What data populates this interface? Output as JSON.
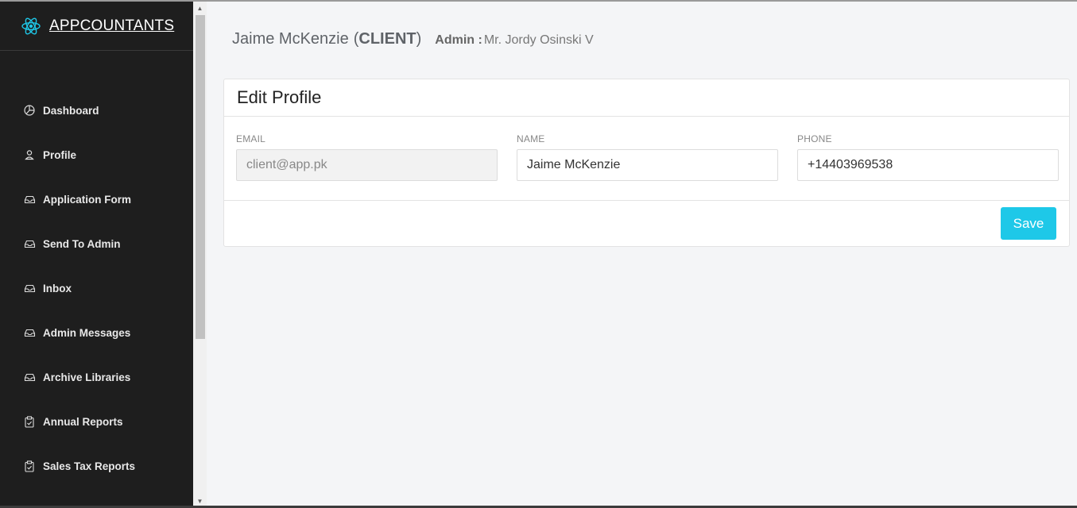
{
  "brand": {
    "title": "APPCOUNTANTS",
    "icon": "react-atom-icon",
    "accent": "#1ec8e8"
  },
  "sidebar": {
    "items": [
      {
        "label": "Dashboard",
        "icon": "pie-chart-icon"
      },
      {
        "label": "Profile",
        "icon": "user-icon"
      },
      {
        "label": "Application Form",
        "icon": "inbox-tray-icon"
      },
      {
        "label": "Send To Admin",
        "icon": "inbox-tray-icon"
      },
      {
        "label": "Inbox",
        "icon": "inbox-tray-icon"
      },
      {
        "label": "Admin Messages",
        "icon": "inbox-tray-icon"
      },
      {
        "label": "Archive Libraries",
        "icon": "inbox-tray-icon"
      },
      {
        "label": "Annual Reports",
        "icon": "clipboard-icon"
      },
      {
        "label": "Sales Tax Reports",
        "icon": "clipboard-icon"
      }
    ]
  },
  "header": {
    "user_name": "Jaime McKenzie",
    "open_paren": "(",
    "role": "CLIENT",
    "close_paren": ")",
    "admin_label": "Admin :",
    "admin_name": "Mr. Jordy Osinski V"
  },
  "profile_form": {
    "title": "Edit Profile",
    "email": {
      "label": "EMAIL",
      "value": "client@app.pk"
    },
    "name": {
      "label": "NAME",
      "value": "Jaime McKenzie"
    },
    "phone": {
      "label": "PHONE",
      "value": "+14403969538"
    },
    "save_label": "Save"
  }
}
